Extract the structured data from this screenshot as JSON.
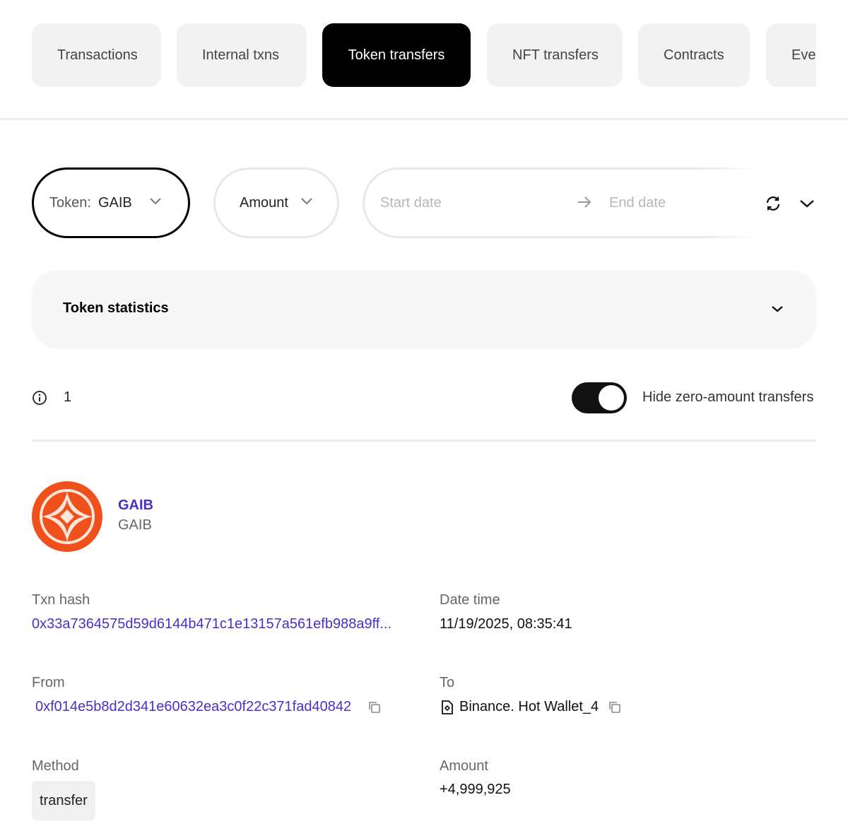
{
  "tabs": [
    {
      "label": "Transactions",
      "active": false
    },
    {
      "label": "Internal txns",
      "active": false
    },
    {
      "label": "Token transfers",
      "active": true
    },
    {
      "label": "NFT transfers",
      "active": false
    },
    {
      "label": "Contracts",
      "active": false
    },
    {
      "label": "Events",
      "active": false
    }
  ],
  "filters": {
    "token_label": "Token:",
    "token_value": "GAIB",
    "amount_label": "Amount",
    "start_date_placeholder": "Start date",
    "end_date_placeholder": "End date"
  },
  "stats": {
    "title": "Token statistics"
  },
  "summary": {
    "count": "1",
    "hide_zero_label": "Hide zero-amount transfers",
    "hide_zero_enabled": true
  },
  "token": {
    "name": "GAIB",
    "symbol": "GAIB",
    "logo_color": "#f0511c"
  },
  "transfer": {
    "txn_hash_label": "Txn hash",
    "txn_hash": "0x33a7364575d59d6144b471c1e13157a561efb988a9ff...",
    "datetime_label": "Date time",
    "datetime": "11/19/2025, 08:35:41",
    "from_label": "From",
    "from": "0xf014e5b8d2d341e60632ea3c0f22c371fad40842",
    "to_label": "To",
    "to": "Binance. Hot Wallet_4",
    "method_label": "Method",
    "method": "transfer",
    "amount_label": "Amount",
    "amount": "+4,999,925"
  },
  "colors": {
    "accent_link": "#4b2fc9",
    "active_tab": "#000000",
    "token_logo": "#f0511c"
  }
}
